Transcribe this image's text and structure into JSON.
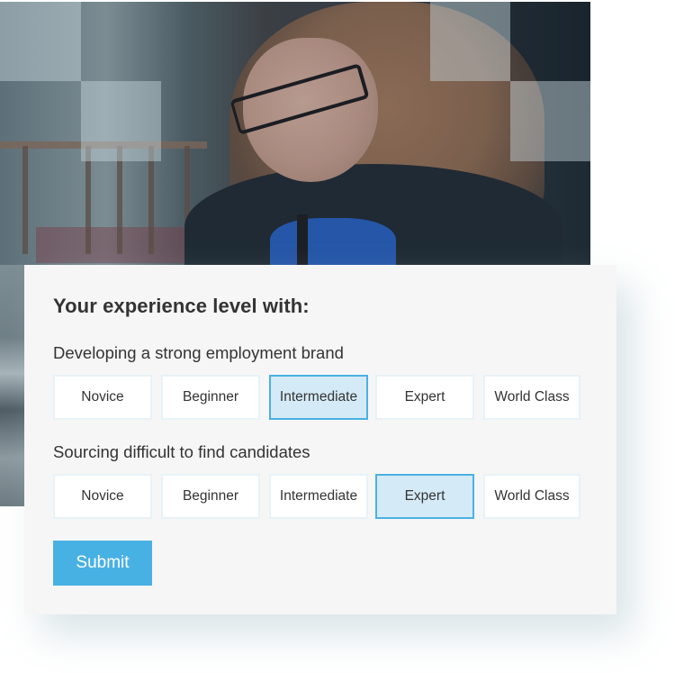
{
  "hero_image": {
    "description": "Woman with long brown hair and black glasses looking down, wearing a dark jacket over a blue top with a lanyard, blurred event venue background with translucent square overlays"
  },
  "form": {
    "title": "Your experience level with:",
    "questions": [
      {
        "label": "Developing a strong employment brand",
        "options": [
          "Novice",
          "Beginner",
          "Intermediate",
          "Expert",
          "World Class"
        ],
        "selected": "Intermediate"
      },
      {
        "label": "Sourcing difficult to find candidates",
        "options": [
          "Novice",
          "Beginner",
          "Intermediate",
          "Expert",
          "World Class"
        ],
        "selected": "Expert"
      }
    ],
    "submit_label": "Submit"
  },
  "colors": {
    "accent": "#48b1e3",
    "selected_bg": "#d4eaf7",
    "selected_border": "#4ab1e2",
    "card_bg": "#f6f6f6",
    "text": "#333333"
  }
}
